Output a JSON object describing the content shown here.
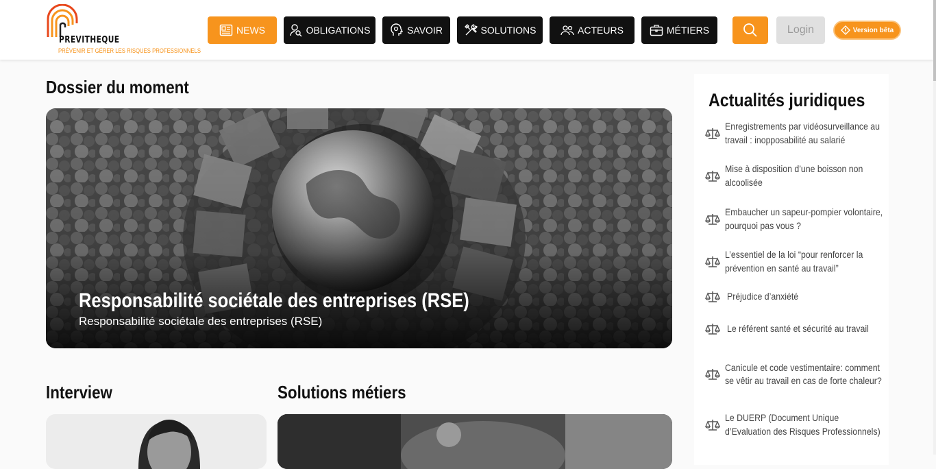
{
  "header": {
    "logo_name": "PREVITHEQUE",
    "logo_tagline": "PRÉVENIR ET GÉRER LES RISQUES PROFESSIONNELS",
    "nav": [
      {
        "label": "NEWS",
        "icon": "newspaper-icon",
        "active": true
      },
      {
        "label": "OBLIGATIONS",
        "icon": "person-search-icon",
        "active": false
      },
      {
        "label": "SAVOIR",
        "icon": "lightbulb-head-icon",
        "active": false
      },
      {
        "label": "SOLUTIONS",
        "icon": "tools-icon",
        "active": false
      },
      {
        "label": "ACTEURS",
        "icon": "people-icon",
        "active": false
      },
      {
        "label": "MÉTIERS",
        "icon": "briefcase-icon",
        "active": false
      }
    ],
    "search_icon": "search-icon",
    "login_label": "Login",
    "beta_label": "Version bêta"
  },
  "main": {
    "dossier_title": "Dossier du moment",
    "hero": {
      "title": "Responsabilité sociétale des entreprises (RSE)",
      "subtitle": "Responsabilité sociétale des entreprises (RSE)"
    },
    "interview_title": "Interview",
    "solutions_title": "Solutions métiers"
  },
  "sidebar": {
    "title": "Actualités juridiques",
    "icon": "balance-scale-icon",
    "items": [
      {
        "label": "Enregistrements par vidéosurveillance au travail : inopposabilité au salarié"
      },
      {
        "label": "Mise à disposition d’une boisson non alcoolisée"
      },
      {
        "label": "Embaucher un sapeur-pompier volontaire, pourquoi pas vous ?"
      },
      {
        "label": "L’essentiel de la loi “pour renforcer la prévention en santé au travail”"
      },
      {
        "label": "Préjudice d’anxiété"
      },
      {
        "label": "Le référent santé et sécurité au travail"
      },
      {
        "label": "Canicule et code vestimentaire: comment se vêtir au travail en cas de forte chaleur?"
      },
      {
        "label": "Le DUERP (Document Unique d’Evaluation des Risques Professionnels)"
      }
    ]
  },
  "colors": {
    "accent": "#f7941d",
    "nav_bg": "#111111",
    "login_bg": "#e0e0e0"
  }
}
